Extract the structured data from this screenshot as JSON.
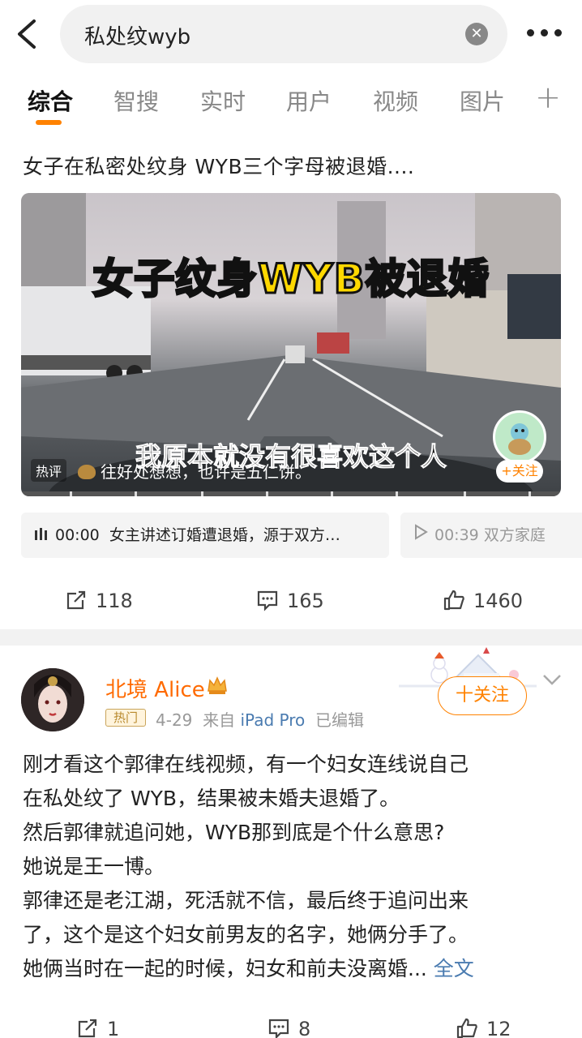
{
  "search": {
    "query": "私处纹wyb",
    "clear_icon": "clear-icon",
    "back_icon": "back-arrow-icon",
    "more_icon": "more-dots-icon"
  },
  "tabs": [
    {
      "label": "综合",
      "active": true
    },
    {
      "label": "智搜"
    },
    {
      "label": "实时"
    },
    {
      "label": "用户"
    },
    {
      "label": "视频"
    },
    {
      "label": "图片"
    }
  ],
  "tab_add": "+",
  "post1": {
    "headline": "女子在私密处纹身 WYB三个字母被退婚....",
    "video": {
      "title": "女子纹身WYB被退婚",
      "subtitle": "我原本就没有很喜欢这个人",
      "hot_tag": "热评",
      "hot_comment": "往好处想想，也许是五仁饼。",
      "follow": "+关注"
    },
    "chapters": [
      {
        "icon": "audio-bars-icon",
        "time": "00:00",
        "text": "女主讲述订婚遭退婚，源于双方…"
      },
      {
        "icon": "play-icon",
        "time": "00:39",
        "text": "双方家庭"
      }
    ],
    "actions": {
      "reposts": "118",
      "comments": "165",
      "likes": "1460"
    }
  },
  "post2": {
    "username": "北境 Alice",
    "badge": "热门",
    "date": "4-29",
    "source_prefix": "来自",
    "source": "iPad Pro",
    "edited": "已编辑",
    "follow": "十关注",
    "lines": [
      "刚才看这个郭律在线视频，有一个妇女连线说自己",
      "在私处纹了 WYB，结果被未婚夫退婚了。",
      "然后郭律就追问她，WYB那到底是个什么意思?",
      "她说是王一博。",
      "郭律还是老江湖，死活就不信，最后终于追问出来",
      "了，这个是这个妇女前男友的名字，她俩分手了。",
      "她俩当时在一起的时候，妇女和前夫没离婚..."
    ],
    "full_text": "全文",
    "actions": {
      "reposts": "1",
      "comments": "8",
      "likes": "12"
    }
  },
  "colors": {
    "accent": "#ff8200",
    "link": "#4a7bb0",
    "username": "#ff6a00"
  }
}
